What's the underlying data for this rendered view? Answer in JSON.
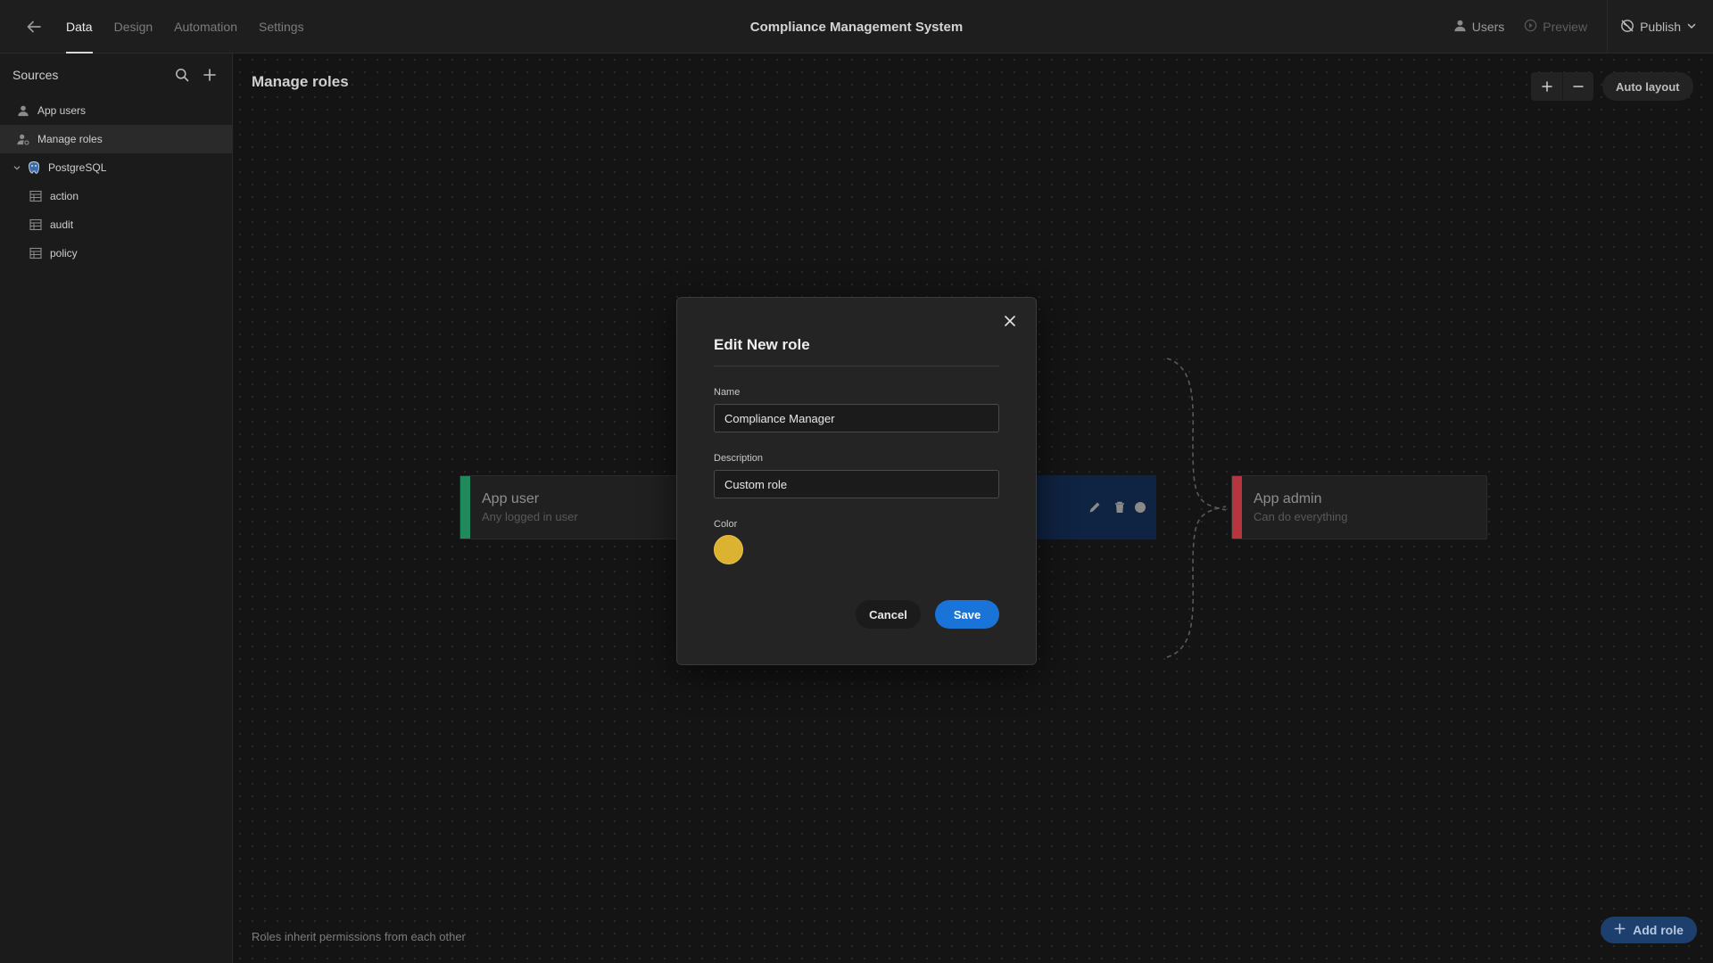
{
  "topbar": {
    "back_icon": "arrow-left-icon",
    "tabs": [
      {
        "label": "Data",
        "active": true
      },
      {
        "label": "Design",
        "active": false
      },
      {
        "label": "Automation",
        "active": false
      },
      {
        "label": "Settings",
        "active": false
      }
    ],
    "app_title": "Compliance Management System",
    "users_label": "Users",
    "preview_label": "Preview",
    "publish_label": "Publish"
  },
  "sidebar": {
    "header": "Sources",
    "items": [
      {
        "label": "App users",
        "icon": "user-icon"
      },
      {
        "label": "Manage roles",
        "icon": "user-cog-icon",
        "active": true
      },
      {
        "label": "PostgreSQL",
        "icon": "postgresql-icon"
      },
      {
        "label": "action",
        "icon": "table-icon"
      },
      {
        "label": "audit",
        "icon": "table-icon"
      },
      {
        "label": "policy",
        "icon": "table-icon"
      }
    ]
  },
  "canvas": {
    "title": "Manage roles",
    "auto_layout_label": "Auto layout",
    "footer_note": "Roles inherit permissions from each other",
    "add_role_label": "Add role",
    "roles": [
      {
        "name": "App user",
        "description": "Any logged in user",
        "color": "#1f8a5c"
      },
      {
        "name": "App admin",
        "description": "Can do everything",
        "color": "#b8343f"
      }
    ]
  },
  "modal": {
    "title": "Edit New role",
    "name_label": "Name",
    "name_value": "Compliance Manager",
    "description_label": "Description",
    "description_value": "Custom role",
    "color_label": "Color",
    "color_value": "#dcb233",
    "cancel_label": "Cancel",
    "save_label": "Save"
  }
}
